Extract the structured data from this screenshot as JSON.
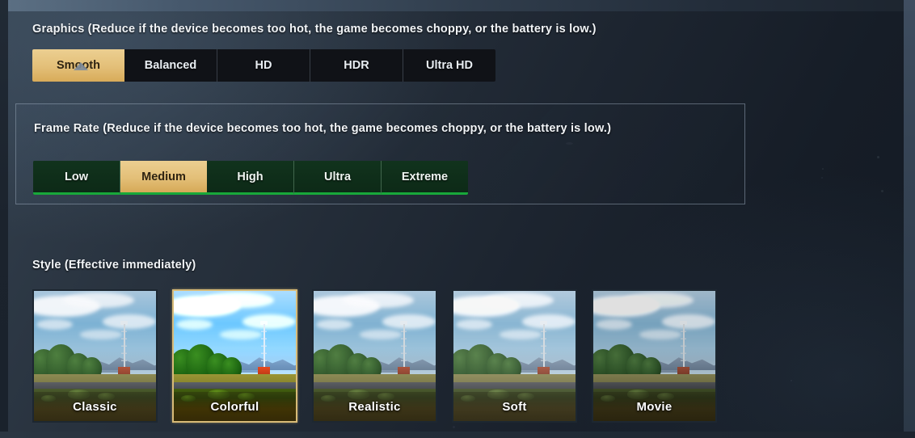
{
  "graphics": {
    "title": "Graphics (Reduce if the device becomes too hot, the game becomes choppy, or the battery is low.)",
    "selected": "Smooth",
    "options": [
      {
        "label": "Smooth"
      },
      {
        "label": "Balanced"
      },
      {
        "label": "HD"
      },
      {
        "label": "HDR"
      },
      {
        "label": "Ultra HD"
      }
    ]
  },
  "frame_rate": {
    "title": "Frame Rate (Reduce if the device becomes too hot, the game becomes choppy, or the battery is low.)",
    "selected": "Medium",
    "options": [
      {
        "label": "Low"
      },
      {
        "label": "Medium"
      },
      {
        "label": "High"
      },
      {
        "label": "Ultra"
      },
      {
        "label": "Extreme"
      }
    ]
  },
  "style": {
    "title": "Style (Effective immediately)",
    "selected": "Colorful",
    "options": [
      {
        "label": "Classic"
      },
      {
        "label": "Colorful"
      },
      {
        "label": "Realistic"
      },
      {
        "label": "Soft"
      },
      {
        "label": "Movie"
      }
    ]
  },
  "colors": {
    "selected_gold": "#e3bf78",
    "selected_gold_text": "#2e2312",
    "frame_rate_green": "#18a83a",
    "frame_rate_fill": "#0d2a17",
    "unselected_fill": "#101217",
    "panel_border": "#a6b6c7",
    "text": "#f2f5f8"
  }
}
